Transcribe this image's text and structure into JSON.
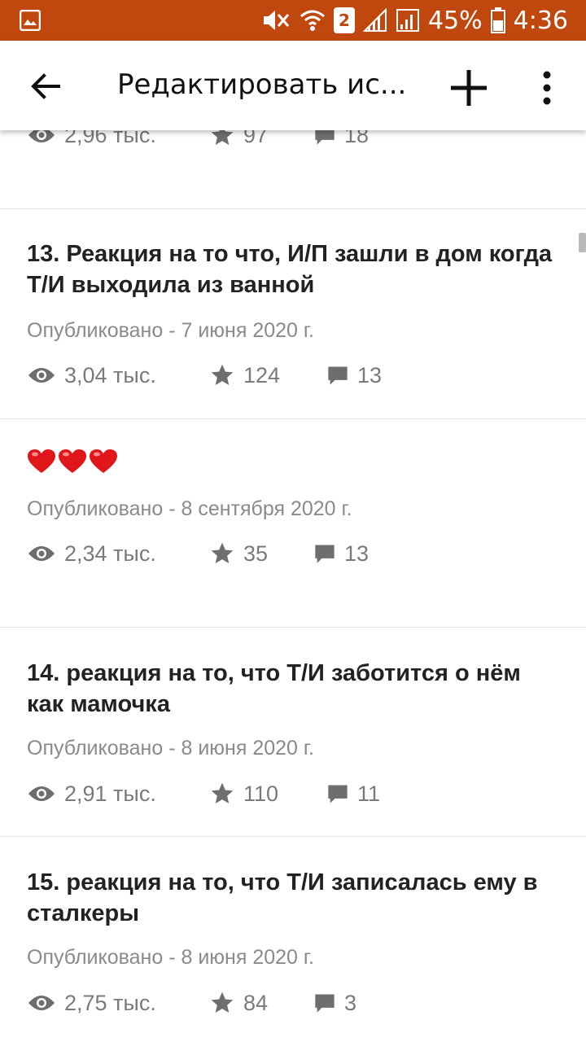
{
  "status_bar": {
    "sim_slot": "2",
    "battery": "45%",
    "time": "4:36"
  },
  "app_bar": {
    "title": "Редактировать ис...",
    "icons": [
      "back-arrow-icon",
      "add-icon",
      "more-vert-icon"
    ]
  },
  "stories": [
    {
      "title": "",
      "date": "",
      "views": "2,96 тыс.",
      "votes": "97",
      "comments": "18"
    },
    {
      "title": "13. Реакция на то что, И/П зашли в дом когда Т/И выходила из ванной",
      "date": "Опубликовано - 7 июня 2020 г.",
      "views": "3,04 тыс.",
      "votes": "124",
      "comments": "13"
    },
    {
      "title": "❤❤❤",
      "date": "Опубликовано - 8 сентября 2020 г.",
      "views": "2,34 тыс.",
      "votes": "35",
      "comments": "13"
    },
    {
      "title": "14. реакция на то, что Т/И заботится о нём как мамочка",
      "date": "Опубликовано - 8 июня 2020 г.",
      "views": "2,91 тыс.",
      "votes": "110",
      "comments": "11"
    },
    {
      "title": "15. реакция на то, что Т/И записалась ему в сталкеры",
      "date": "Опубликовано - 8 июня 2020 г.",
      "views": "2,75 тыс.",
      "votes": "84",
      "comments": "3"
    }
  ],
  "colors": {
    "status_bar": "#c0480f",
    "heart": "#e0161b",
    "meta_text": "#8a8a8a"
  }
}
